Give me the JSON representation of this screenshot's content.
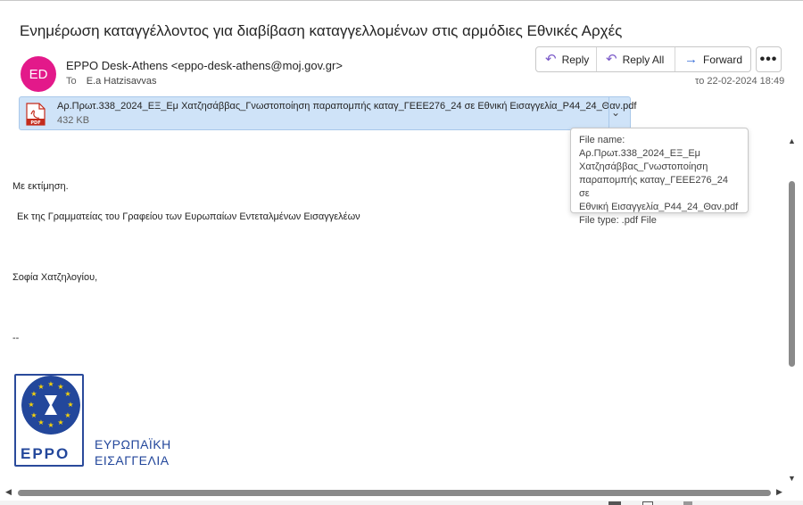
{
  "email": {
    "subject": "Ενημέρωση καταγγέλλοντος για διαβίβαση καταγγελλομένων στις αρμόδιες Εθνικές Αρχές",
    "sender_initials": "ED",
    "sender": "EPPO Desk-Athens <eppo-desk-athens@moj.gov.gr>",
    "to_label": "To",
    "to": "E.a Hatzisavvas",
    "date": "το 22-02-2024 18:49"
  },
  "actions": {
    "reply": "Reply",
    "reply_all": "Reply All",
    "forward": "Forward",
    "more": "•••"
  },
  "attachment": {
    "name": "Αρ.Πρωτ.338_2024_ΕΞ_Εμ Χατζησάββας_Γνωστοποίηση παραπομπής καταγ_ΓΕΕΕ276_24 σε Εθνική Εισαγγελία_Ρ44_24_Θαν.pdf",
    "size": "432 KB",
    "icon_label": "PDF"
  },
  "tooltip": {
    "line1": "File name:  Αρ.Πρωτ.338_2024_ΕΞ_Εμ",
    "line2": "Χατζησάββας_Γνωστοποίηση",
    "line3": "παραπομπής καταγ_ΓΕΕΕ276_24 σε",
    "line4": "Εθνική Εισαγγελία_Ρ44_24_Θαν.pdf",
    "line5": "File type:  .pdf File"
  },
  "body": {
    "greeting": "Με εκτίμηση.",
    "from_line": "Εκ της Γραμματείας του Γραφείου των Ευρωπαίων Εντεταλμένων Εισαγγελέων",
    "signature": "Σοφία Χατζηλογίου,",
    "separator": "--"
  },
  "logo": {
    "acronym": "EPPO",
    "text_line1": "ΕΥΡΩΠΑΪΚΗ",
    "text_line2": "ΕΙΣΑΓΓΕΛΙΑ"
  },
  "colors": {
    "avatar": "#e3198a",
    "accent": "#7a59c8",
    "attachment_bg": "#cfe3f8",
    "logo_blue": "#23479b"
  }
}
